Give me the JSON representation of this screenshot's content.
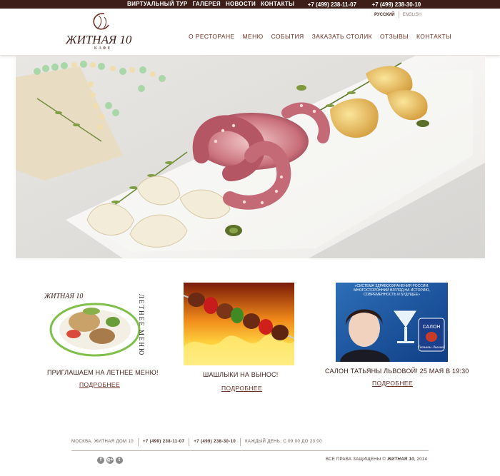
{
  "topbar": {
    "links": [
      "ВИРТУАЛЬНЫЙ ТУР",
      "ГАЛЕРЕЯ",
      "НОВОСТИ",
      "КОНТАКТЫ"
    ],
    "phone1": "+7 (499) 238-11-07",
    "phone2": "+7 (499) 238-30-10"
  },
  "lang": {
    "current": "РУССКИЙ",
    "other": "ENGLISH"
  },
  "logo": {
    "name": "ЖИТНАЯ 10",
    "sub": "КАФЕ"
  },
  "nav": [
    "О РЕСТОРАНЕ",
    "МЕНЮ",
    "СОБЫТИЯ",
    "ЗАКАЗАТЬ СТОЛИК",
    "ОТЗЫВЫ",
    "КОНТАКТЫ"
  ],
  "promos": [
    {
      "title": "ПРИГЛАШАЕМ НА ЛЕТНЕЕ МЕНЮ!",
      "more": "ПОДРОБНЕЕ",
      "image_logo_text": "ЖИТНАЯ 10",
      "image_vertical_text_1": "ЛЕТНЕЕ",
      "image_vertical_text_2": "МЕНЮ"
    },
    {
      "title": "ШАШЛЫКИ НА ВЫНОС!",
      "more": "ПОДРОБНЕЕ"
    },
    {
      "title": "САЛОН ТАТЬЯНЫ ЛЬВОВОЙ! 25 МАЯ В 19:30",
      "more": "ПОДРОБНЕЕ",
      "image_header": "«СИСТЕМА ЗДРАВООХРАНЕНИЯ РОССИИ: МНОГОСТОРОННИЙ ВЗГЛЯД НА ИСТОРИЮ, СОВРЕМЕННОСТЬ И БУДУЩЕЕ»",
      "image_badge_1": "САЛОН",
      "image_badge_2": "Татьяны Львовой"
    }
  ],
  "footer": {
    "address": "МОСКВА, ЖИТНАЯ ДОМ 10",
    "phone1": "+7 (499) 238-11-07",
    "phone2": "+7 (499) 238-30-10",
    "hours": "КАЖДЫЙ ДЕНЬ, С 09:00 ДО 23:00",
    "copyright_prefix": "ВСЕ ПРАВА ЗАЩИЩЕНЫ ©",
    "copyright_brand": "ЖИТНАЯ 10",
    "copyright_year": ", 2014",
    "social": [
      "f",
      "g+",
      "t"
    ]
  },
  "colors": {
    "brand_dark": "#3d1e19",
    "nav_text": "#6a2e22",
    "page_bg": "#ffffff"
  },
  "icons": {
    "social": [
      "facebook-icon",
      "google-plus-icon",
      "twitter-icon"
    ]
  }
}
